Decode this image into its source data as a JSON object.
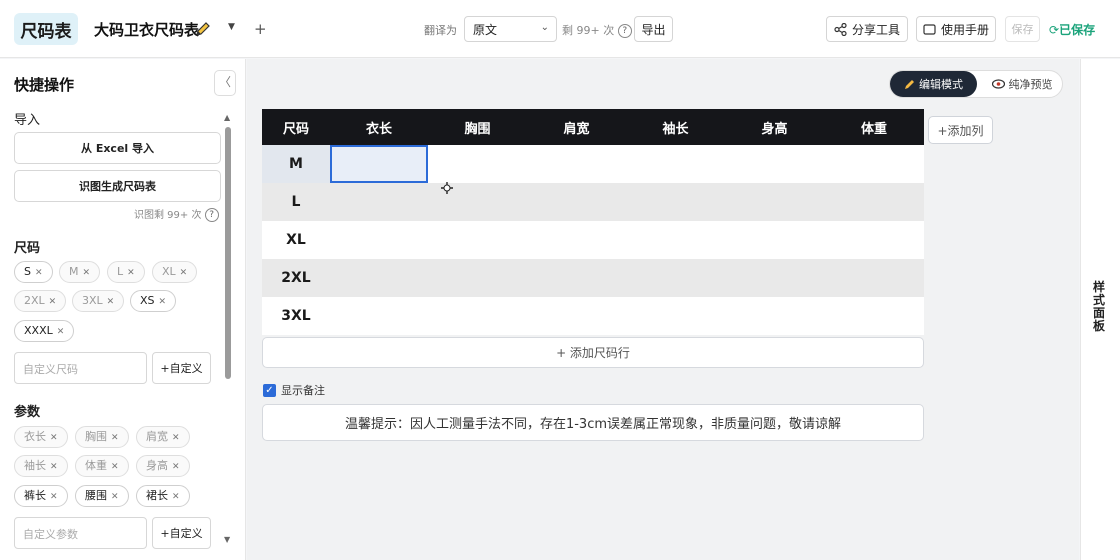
{
  "header": {
    "logo": "尺码表",
    "doc_title": "大码卫衣尺码表",
    "new_tab": "+",
    "translate_label": "翻译为",
    "translate_value": "原文",
    "quota": "剩 99+ 次",
    "help": "?",
    "export": "导出",
    "share": "分享工具",
    "manual": "使用手册",
    "save": "保存",
    "saved": "已保存"
  },
  "sidebar": {
    "title": "快捷操作",
    "collapse": "〈",
    "import_label": "导入",
    "import_excel": "从 Excel 导入",
    "ocr_generate": "识图生成尺码表",
    "ocr_quota": "识图剩 99+ 次",
    "sizes_label": "尺码",
    "sizes": [
      "S",
      "M",
      "L",
      "XL",
      "2XL",
      "3XL",
      "XS",
      "XXXL"
    ],
    "custom_size_placeholder": "自定义尺码",
    "custom_btn": "+自定义",
    "params_label": "参数",
    "params": [
      "衣长",
      "胸围",
      "肩宽",
      "袖长",
      "体重",
      "身高",
      "裤长",
      "腰围",
      "裙长"
    ],
    "custom_param_placeholder": "自定义参数"
  },
  "main": {
    "mode_edit": "编辑模式",
    "mode_preview": "纯净预览",
    "columns": [
      "尺码",
      "衣长",
      "胸围",
      "肩宽",
      "袖长",
      "身高",
      "体重"
    ],
    "rows": [
      "M",
      "L",
      "XL",
      "2XL",
      "3XL"
    ],
    "add_column": "+添加列",
    "add_row": "+ 添加尺码行",
    "show_note": "显示备注",
    "note": "温馨提示：因人工测量手法不同，存在1-3cm误差属正常现象，非质量问题，敬请谅解"
  },
  "rail": {
    "label": "样式面板"
  },
  "colors": {
    "accent": "#2c6bd8",
    "header_bg": "#15161a",
    "saved_green": "#1aa37a"
  }
}
